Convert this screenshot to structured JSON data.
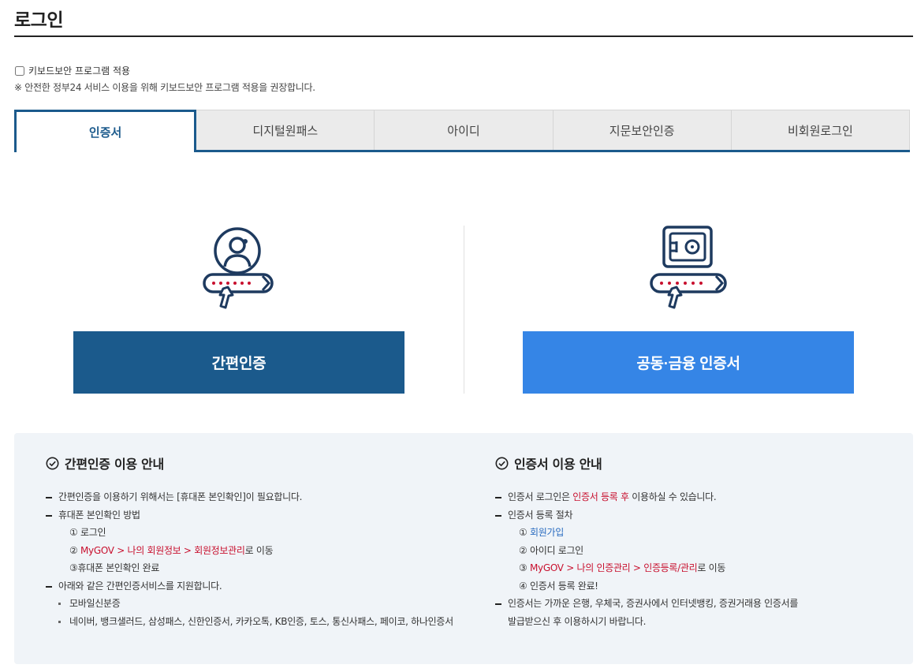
{
  "page": {
    "title": "로그인"
  },
  "keyboard_security": {
    "checkbox_label": "키보드보안 프로그램 적용",
    "checked": false,
    "note": "※ 안전한 정부24 서비스 이용을 위해 키보드보안 프로그램 적용을 권장합니다."
  },
  "tabs": [
    {
      "label": "인증서",
      "active": true
    },
    {
      "label": "디지털원패스",
      "active": false
    },
    {
      "label": "아이디",
      "active": false
    },
    {
      "label": "지문보안인증",
      "active": false
    },
    {
      "label": "비회원로그인",
      "active": false
    }
  ],
  "auth": {
    "simple_label": "간편인증",
    "cert_label": "공동·금융 인증서"
  },
  "colors": {
    "primary": "#1b5a8c",
    "accent": "#3585e6",
    "highlight": "#c8102e",
    "panel": "#f0f4f8"
  },
  "icons": {
    "simple": "user-password-icon",
    "cert": "safe-password-icon",
    "heading": "check-circle-icon"
  },
  "simple_info": {
    "heading": "간편인증 이용 안내",
    "item1": "간편인증을 이용하기 위해서는 [휴대폰 본인확인]이 필요합니다.",
    "item2": "휴대폰 본인확인 방법",
    "step1": "① 로그인",
    "step2_num": "② ",
    "step2_path": "MyGOV > 나의 회원정보 > 회원정보관리",
    "step2_suffix": "로 이동",
    "step3": "③휴대폰 본인확인 완료",
    "item3": "아래와 같은 간편인증서비스를 지원합니다.",
    "bullet1": "모바일신분증",
    "bullet2": "네이버, 뱅크샐러드, 삼성패스, 신한인증서, 카카오톡, KB인증, 토스, 통신사패스, 페이코, 하나인증서"
  },
  "cert_info": {
    "heading": "인증서 이용 안내",
    "item1_prefix": "인증서 로그인은 ",
    "item1_highlight": "인증서 등록 후",
    "item1_suffix": " 이용하실 수 있습니다.",
    "item2": "인증서 등록 절차",
    "step1_num": "① ",
    "step1_link": "회원가입",
    "step2": "② 아이디 로그인",
    "step3_num": "③ ",
    "step3_path": "MyGOV > 나의 인증관리 > 인증등록/관리",
    "step3_suffix": "로 이동",
    "step4": "④ 인증서 등록 완료!",
    "item3_line1": "인증서는 가까운 은행, 우체국, 증권사에서 인터넷뱅킹, 증권거래용 인증서를",
    "item3_line2": "발급받으신 후 이용하시기 바랍니다."
  }
}
